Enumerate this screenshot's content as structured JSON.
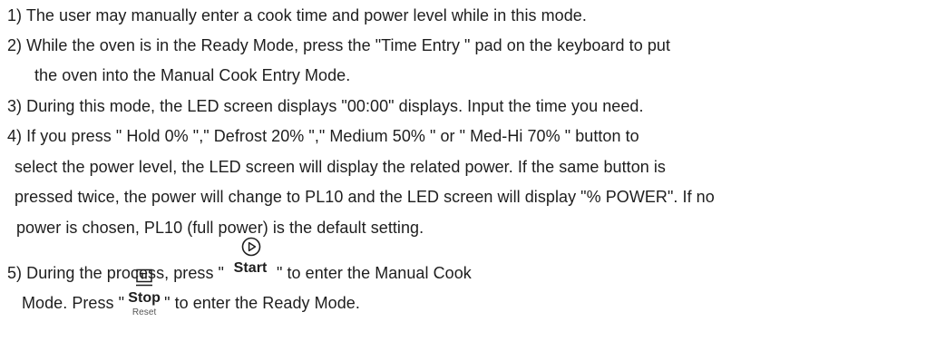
{
  "instructions": {
    "item1": "1) The user may manually enter a cook time and power level while in this mode.",
    "item2_line1": "2) While the oven is in the Ready Mode, press the \"Time Entry  \" pad on the keyboard to put",
    "item2_line2": "the oven into the Manual Cook Entry Mode.",
    "item3": "3) During this mode,  the LED screen displays \"00:00\" displays. Input the time you need.",
    "item4_line1": "4) If you press \" Hold 0% \",\" Defrost 20%  \",\" Medium 50% \" or \" Med-Hi 70% \" button to",
    "item4_line2": "select the power level, the LED screen will display the related power. If the same button is",
    "item4_line3": "pressed twice, the power will change to PL10 and the LED screen will display \"% POWER\". If no",
    "item4_line4": "power is chosen, PL10 (full power) is the default setting.",
    "item5_line1_before": "5)  During the  process, press \"",
    "item5_line1_after": "\" to enter the Manual Cook",
    "item5_line2_before": "Mode. Press \"",
    "item5_line2_after": "\" to enter the Ready Mode."
  },
  "buttons": {
    "start": {
      "label": "Start",
      "icon": "play-circle-icon"
    },
    "stop": {
      "label": "Stop",
      "sublabel": "Reset",
      "icon": "pause-square-icon"
    }
  },
  "colors": {
    "text": "#1e1e1e",
    "background": "#ffffff"
  }
}
